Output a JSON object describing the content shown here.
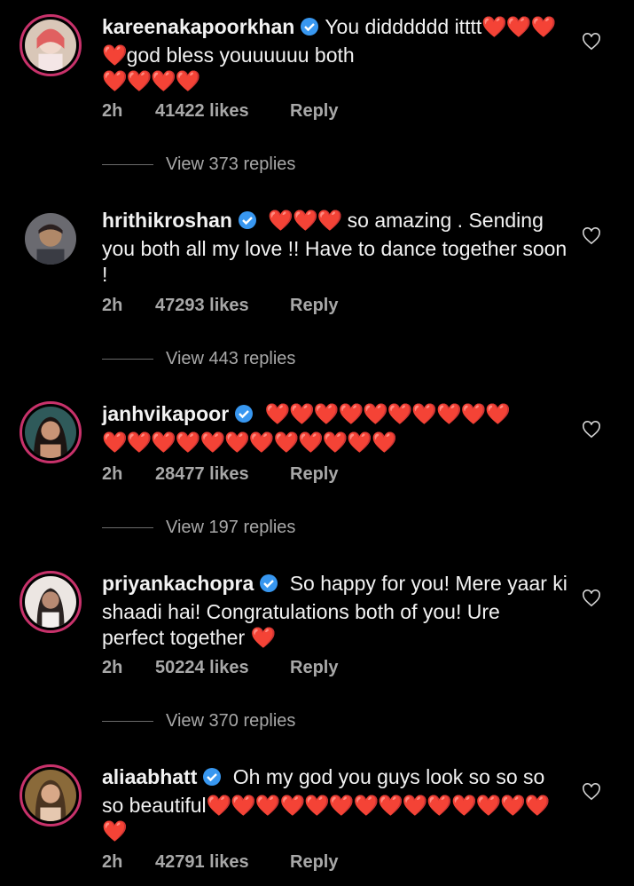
{
  "comments": [
    {
      "username": "kareenakapoorkhan",
      "text_before": "You didddddd itttt",
      "text_hearts_inline": "❤️❤️❤️❤️",
      "text_after": "god bless youuuuuu both",
      "text_hearts_end": "❤️❤️❤️❤️",
      "time": "2h",
      "likes": "41422 likes",
      "reply": "Reply",
      "view_replies": "View 373 replies"
    },
    {
      "username": "hrithikroshan",
      "text_hearts_inline": "❤️❤️❤️",
      "text_after": "so amazing . Sending you both all my love !! Have to dance together soon !",
      "time": "2h",
      "likes": "47293 likes",
      "reply": "Reply",
      "view_replies": "View 443 replies"
    },
    {
      "username": "janhvikapoor",
      "text_hearts_inline": "❤️❤️❤️❤️❤️❤️❤️❤️❤️❤️",
      "text_hearts_end": "❤️❤️❤️❤️❤️❤️❤️❤️❤️❤️❤️❤️",
      "time": "2h",
      "likes": "28477 likes",
      "reply": "Reply",
      "view_replies": "View 197 replies"
    },
    {
      "username": "priyankachopra",
      "text_after": "So happy for you! Mere yaar ki shaadi hai! Congratulations both of you! Ure perfect together",
      "text_hearts_end": "❤️",
      "time": "2h",
      "likes": "50224 likes",
      "reply": "Reply",
      "view_replies": "View 370 replies"
    },
    {
      "username": "aliaabhatt",
      "text_after": "Oh my god you guys look so so so so beautiful",
      "text_hearts_end": "❤️❤️❤️❤️❤️❤️❤️❤️❤️❤️❤️❤️❤️❤️❤️",
      "time": "2h",
      "likes": "42791 likes",
      "reply": "Reply"
    }
  ],
  "colors": {
    "background": "#000000",
    "text": "#f2f2f2",
    "meta": "#a8a8a8",
    "verified": "#3897f0",
    "heart": "#e0162b",
    "avatar_ring": "#c8326b"
  }
}
